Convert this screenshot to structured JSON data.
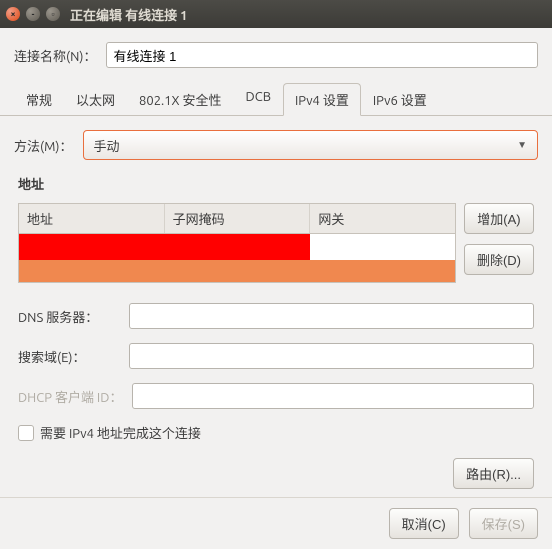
{
  "window": {
    "title": "正在编辑 有线连接 1"
  },
  "connName": {
    "label": "连接名称(N)：",
    "value": "有线连接 1"
  },
  "tabs": [
    "常规",
    "以太网",
    "802.1X 安全性",
    "DCB",
    "IPv4 设置",
    "IPv6 设置"
  ],
  "activeTab": 4,
  "method": {
    "label": "方法(M)：",
    "value": "手动"
  },
  "address": {
    "title": "地址",
    "headers": [
      "地址",
      "子网掩码",
      "网关"
    ],
    "addBtn": "增加(A)",
    "delBtn": "删除(D)"
  },
  "fields": {
    "dns": {
      "label": "DNS 服务器：",
      "value": ""
    },
    "search": {
      "label": "搜索域(E)：",
      "value": ""
    },
    "dhcp": {
      "label": "DHCP 客户端 ID：",
      "value": ""
    }
  },
  "requireChk": "需要 IPv4 地址完成这个连接",
  "routesBtn": "路由(R)...",
  "footer": {
    "cancel": "取消(C)",
    "save": "保存(S)"
  }
}
